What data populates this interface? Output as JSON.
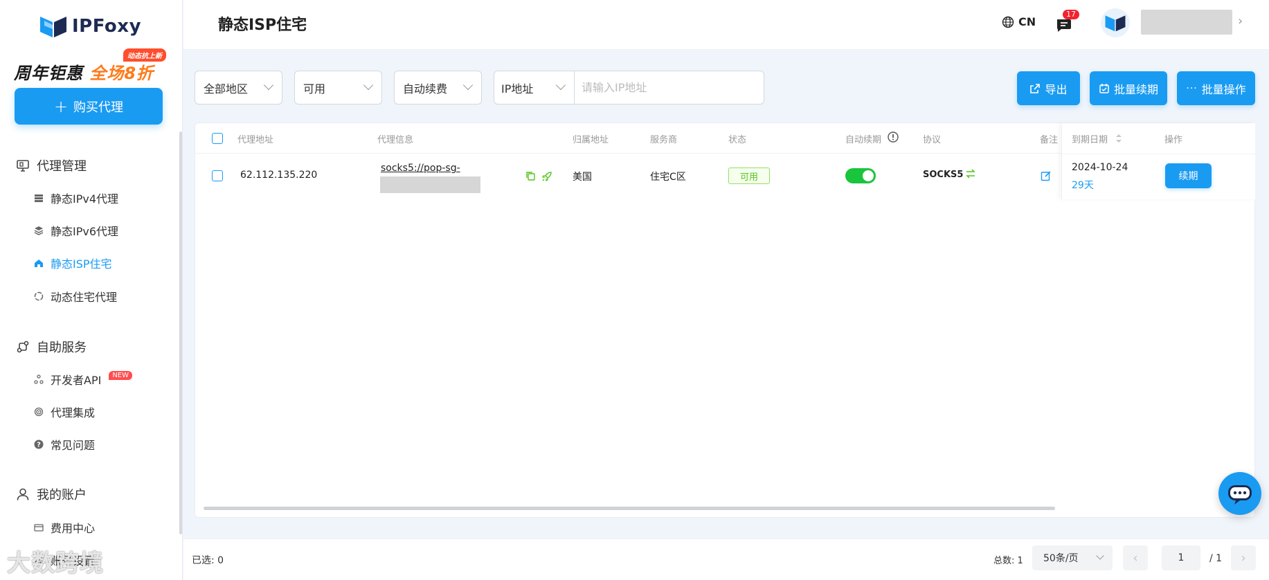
{
  "brand": {
    "name": "IPFoxy"
  },
  "promo": {
    "badge": "动态抗上新",
    "text_prefix": "周年钜惠",
    "text_highlight": "全场8折"
  },
  "sidebar": {
    "buy_label": "购买代理",
    "groups": [
      {
        "label": "代理管理",
        "icon": "proxy-manage-icon",
        "items": [
          {
            "label": "静态IPv4代理",
            "icon": "server-icon",
            "active": false
          },
          {
            "label": "静态IPv6代理",
            "icon": "layers-icon",
            "active": false
          },
          {
            "label": "静态ISP住宅",
            "icon": "home-icon",
            "active": true
          },
          {
            "label": "动态住宅代理",
            "icon": "refresh-icon",
            "active": false
          }
        ]
      },
      {
        "label": "自助服务",
        "icon": "self-service-icon",
        "items": [
          {
            "label": "开发者API",
            "icon": "api-icon",
            "tag": "NEW"
          },
          {
            "label": "代理集成",
            "icon": "integration-icon"
          },
          {
            "label": "常见问题",
            "icon": "question-icon"
          }
        ]
      },
      {
        "label": "我的账户",
        "icon": "user-icon",
        "items": [
          {
            "label": "费用中心",
            "icon": "card-icon"
          },
          {
            "label": "账号设置",
            "icon": "settings-icon"
          }
        ]
      }
    ]
  },
  "watermark": "大数跨境",
  "header": {
    "title": "静态ISP住宅",
    "lang": "CN",
    "message_count": "17"
  },
  "filters": {
    "region": "全部地区",
    "status": "可用",
    "auto_renew": "自动续费",
    "ip_type": "IP地址",
    "ip_placeholder": "请输入IP地址"
  },
  "actions": {
    "export": "导出",
    "batch_renew": "批量续期",
    "batch_ops": "批量操作"
  },
  "table": {
    "headers": {
      "address": "代理地址",
      "info": "代理信息",
      "location": "归属地址",
      "provider": "服务商",
      "status": "状态",
      "auto_renew": "自动续期",
      "protocol": "协议",
      "remark": "备注",
      "expiry": "到期日期",
      "ops": "操作"
    },
    "rows": [
      {
        "address": "62.112.135.220",
        "info": "socks5://pop-sg-",
        "location": "美国",
        "provider": "住宅C区",
        "status": "可用",
        "auto_renew": true,
        "protocol": "SOCKS5",
        "expiry_date": "2024-10-24",
        "days_left": "29天",
        "renew_label": "续期"
      }
    ]
  },
  "footer": {
    "selected": "已选: 0",
    "total": "总数: 1",
    "page_size": "50条/页",
    "current_page": "1",
    "total_pages": "/ 1"
  },
  "colors": {
    "primary": "#1a9bf2",
    "success": "#19c53a",
    "danger": "#f5222d",
    "promo": "#ff7a1a"
  }
}
